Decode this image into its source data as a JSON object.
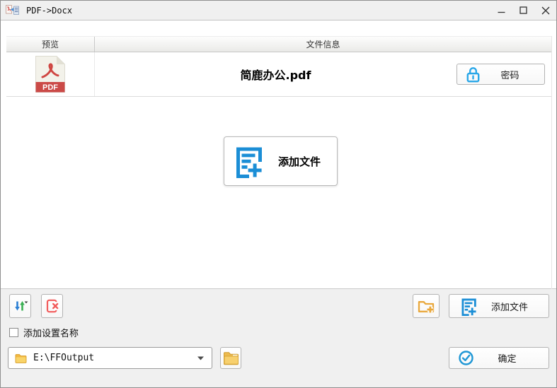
{
  "window": {
    "title": "PDF->Docx"
  },
  "table": {
    "headers": [
      {
        "label": "预览"
      },
      {
        "label": "文件信息"
      }
    ],
    "rows": [
      {
        "filename": "简鹿办公.pdf",
        "type_badge": "PDF",
        "password_button": "密码"
      }
    ]
  },
  "dropzone": {
    "add_files_button": "添加文件"
  },
  "toolbar": {
    "add_files_button": "添加文件"
  },
  "options": {
    "add_name_label": "添加设置名称",
    "checked": false
  },
  "output": {
    "path": "E:\\FFOutput",
    "confirm_button": "确定"
  },
  "colors": {
    "accent_blue": "#1b8ed6",
    "lock_blue": "#2aa7e8",
    "pdf_red": "#cb4a47",
    "folder_yellow": "#f2b740",
    "delete_red": "#f25c5c",
    "sort_green": "#3cb054",
    "sort_blue": "#2b7fd4"
  },
  "icons": {
    "app": "pdf-to-docx-icon",
    "titlebar": [
      "minimize-icon",
      "maximize-icon",
      "close-icon"
    ],
    "row": [
      "pdf-file-icon",
      "lock-icon"
    ],
    "dropzone": "add-file-icon",
    "toolbar": [
      "sort-icon",
      "delete-file-icon",
      "add-folder-icon",
      "add-file-icon"
    ],
    "output": [
      "folder-icon",
      "dropdown-arrow-icon",
      "open-folder-icon",
      "ok-circle-check-icon"
    ]
  }
}
